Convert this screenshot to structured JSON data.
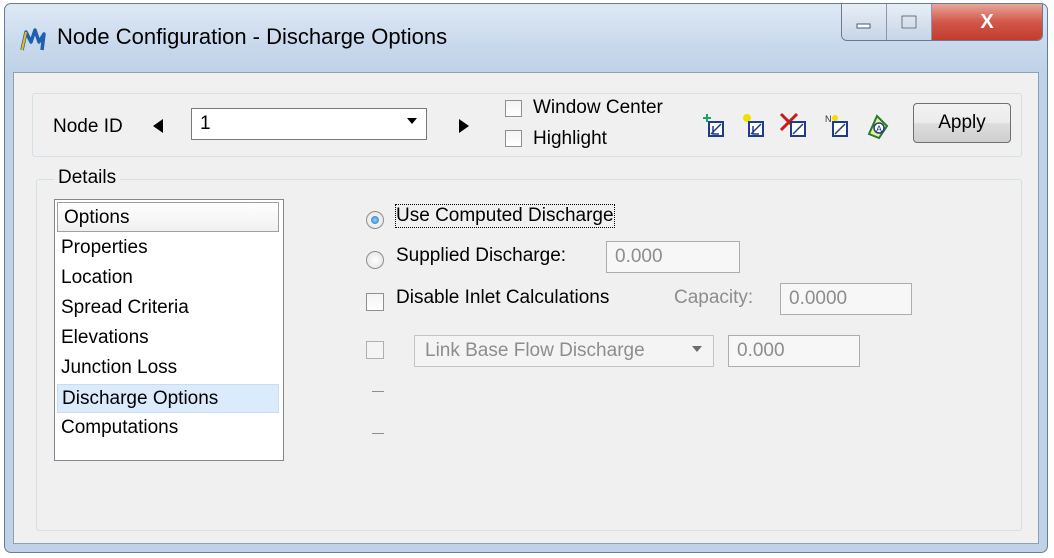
{
  "window": {
    "title": "Node Configuration - Discharge Options",
    "controls": {
      "minimize": "minimize",
      "maximize": "maximize",
      "close": "X"
    }
  },
  "toolbar": {
    "node_id_label": "Node ID",
    "node_id_value": "1",
    "window_center_label": "Window Center",
    "window_center_checked": false,
    "highlight_label": "Highlight",
    "highlight_checked": false,
    "icons": [
      "add-node-icon",
      "select-node-icon",
      "delete-node-icon",
      "renumber-node-icon",
      "annotate-node-icon"
    ],
    "apply_label": "Apply"
  },
  "details": {
    "legend": "Details",
    "list_header": "Options",
    "items": [
      "Properties",
      "Location",
      "Spread Criteria",
      "Elevations",
      "Junction Loss",
      "Discharge Options",
      "Computations"
    ],
    "selected_item": "Discharge Options"
  },
  "discharge": {
    "use_computed_label": "Use Computed Discharge",
    "use_computed_selected": true,
    "supplied_label": "Supplied Discharge:",
    "supplied_value": "0.000",
    "disable_inlet_label": "Disable Inlet Calculations",
    "disable_inlet_checked": false,
    "capacity_label": "Capacity:",
    "capacity_value": "0.0000",
    "base_flow_checked": false,
    "base_flow_option": "Link Base Flow Discharge",
    "base_flow_value": "0.000"
  },
  "colors": {
    "title_gradient_top": "#dfe9f5",
    "client_bg": "#f0f0f0",
    "close_red": "#c33b2e",
    "selected_item_bg": "#dcebfc",
    "disabled_text": "#8d8d8d"
  }
}
